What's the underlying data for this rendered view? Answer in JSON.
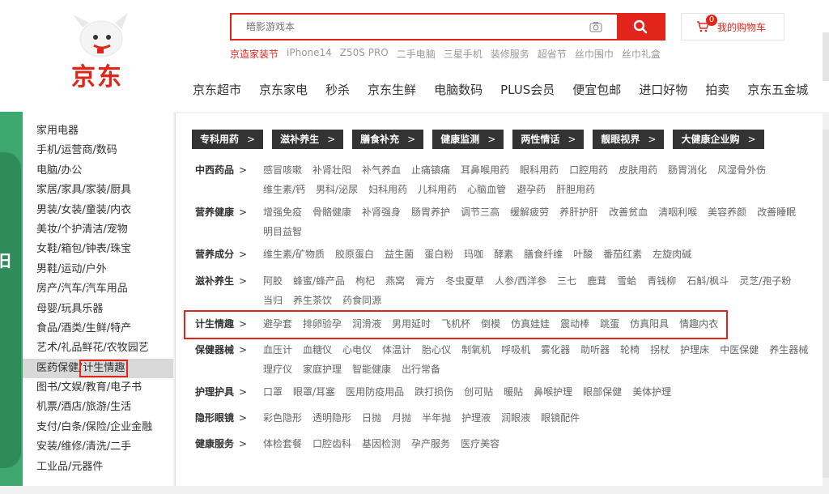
{
  "brand": {
    "logo_text": "京东"
  },
  "search": {
    "placeholder": "暗影游戏本"
  },
  "cart": {
    "badge": "0",
    "label": "我的购物车"
  },
  "hotwords": [
    "京造家装节",
    "iPhone14",
    "Z50S PRO",
    "二手电脑",
    "三星手机",
    "装修服务",
    "超省节",
    "丝巾围巾",
    "丝巾礼盒"
  ],
  "mainnav": [
    "京东超市",
    "京东家电",
    "秒杀",
    "京东生鲜",
    "电脑数码",
    "PLUS会员",
    "便宜包邮",
    "进口好物",
    "拍卖",
    "京东五金城"
  ],
  "banner": {
    "char": "旧"
  },
  "categories": [
    "家用电器",
    "手机/运营商/数码",
    "电脑/办公",
    "家居/家具/家装/厨具",
    "男装/女装/童装/内衣",
    "美妆/个护清洁/宠物",
    "女鞋/箱包/钟表/珠宝",
    "男鞋/运动/户外",
    "房产/汽车/汽车用品",
    "母婴/玩具乐器",
    "食品/酒类/生鲜/特产",
    "艺术/礼品鲜花/农牧园艺",
    "医药保健/",
    "图书/文娱/教育/电子书",
    "机票/酒店/旅游/生活",
    "支付/白条/保险/企业金融",
    "安装/维修/清洗/二手",
    "工业品/元器件"
  ],
  "active_category_suffix": "计生情趣",
  "channels": [
    "专科用药",
    "滋补养生",
    "膳食补充",
    "健康监测",
    "两性情话",
    "靓眼视界",
    "大健康企业购"
  ],
  "arrow": ">",
  "rows": [
    {
      "title": "中西药品",
      "items": [
        "感冒咳嗽",
        "补肾壮阳",
        "补气养血",
        "止痛镇痛",
        "耳鼻喉用药",
        "眼科用药",
        "口腔用药",
        "皮肤用药",
        "肠胃消化",
        "风湿骨外伤",
        "维生素/钙",
        "男科/泌尿",
        "妇科用药",
        "儿科用药",
        "心脑血管",
        "避孕药",
        "肝胆用药"
      ]
    },
    {
      "title": "营养健康",
      "items": [
        "增强免疫",
        "骨骼健康",
        "补肾强身",
        "肠胃养护",
        "调节三高",
        "缓解疲劳",
        "养肝护肝",
        "改善贫血",
        "清咽利喉",
        "美容养颜",
        "改善睡眠",
        "明目益智"
      ]
    },
    {
      "title": "营养成分",
      "items": [
        "维生素/矿物质",
        "胶原蛋白",
        "益生菌",
        "蛋白粉",
        "玛咖",
        "酵素",
        "膳食纤维",
        "叶酸",
        "番茄红素",
        "左旋肉碱"
      ]
    },
    {
      "title": "滋补养生",
      "items": [
        "阿胶",
        "蜂蜜/蜂产品",
        "枸杞",
        "燕窝",
        "膏方",
        "冬虫夏草",
        "人参/西洋参",
        "三七",
        "鹿茸",
        "雪蛤",
        "青钱柳",
        "石斛/枫斗",
        "灵芝/孢子粉",
        "当归",
        "养生茶饮",
        "药食同源"
      ]
    },
    {
      "title": "计生情趣",
      "items": [
        "避孕套",
        "排卵验孕",
        "润滑液",
        "男用延时",
        "飞机杯",
        "倒模",
        "仿真娃娃",
        "震动棒",
        "跳蛋",
        "仿真阳具",
        "情趣内衣"
      ]
    },
    {
      "title": "保健器械",
      "items": [
        "血压计",
        "血糖仪",
        "心电仪",
        "体温计",
        "胎心仪",
        "制氧机",
        "呼吸机",
        "雾化器",
        "助听器",
        "轮椅",
        "拐杖",
        "护理床",
        "中医保健",
        "养生器械",
        "理疗仪",
        "家庭护理",
        "智能健康",
        "出行常备"
      ]
    },
    {
      "title": "护理护具",
      "items": [
        "口罩",
        "眼罩/耳塞",
        "医用防疫用品",
        "跌打损伤",
        "创可贴",
        "暖贴",
        "鼻喉护理",
        "眼部保健",
        "美体护理"
      ]
    },
    {
      "title": "隐形眼镜",
      "items": [
        "彩色隐形",
        "透明隐形",
        "日抛",
        "月抛",
        "半年抛",
        "护理液",
        "润眼液",
        "眼镜配件"
      ]
    },
    {
      "title": "健康服务",
      "items": [
        "体检套餐",
        "口腔齿科",
        "基因检测",
        "孕产服务",
        "医疗美容"
      ]
    }
  ]
}
